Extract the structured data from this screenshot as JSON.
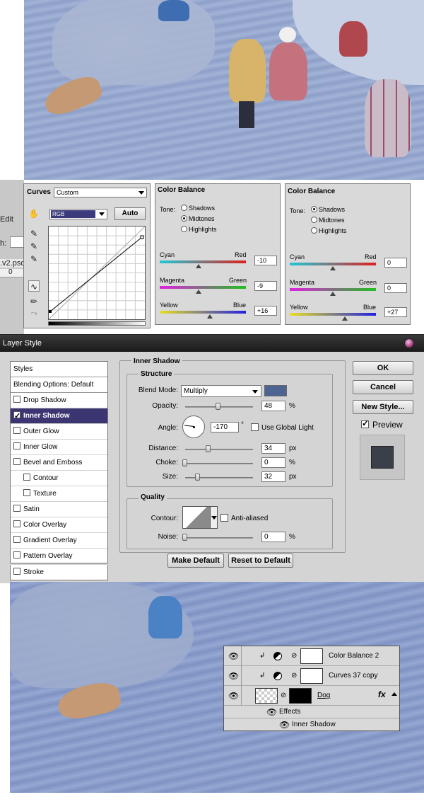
{
  "background": {
    "left_strip": {
      "menu_edit": "Edit",
      "field_label": "h:",
      "file_tab": ".v2.psd",
      "ruler_zero": "0"
    }
  },
  "curves_panel": {
    "title": "Curves",
    "preset": "Custom",
    "channel": "RGB",
    "auto_label": "Auto",
    "tool_icons": [
      "hand-icon",
      "black-eyedropper-icon",
      "gray-eyedropper-icon",
      "white-eyedropper-icon",
      "curve-tool-icon",
      "pencil-icon",
      "smooth-icon"
    ]
  },
  "color_balance_1": {
    "title": "Color Balance",
    "tone_label": "Tone:",
    "tones": [
      "Shadows",
      "Midtones",
      "Highlights"
    ],
    "selected_tone": "Midtones",
    "sliders": [
      {
        "left": "Cyan",
        "right": "Red",
        "value": "-10",
        "pos": 0.45
      },
      {
        "left": "Magenta",
        "right": "Green",
        "value": "-9",
        "pos": 0.45
      },
      {
        "left": "Yellow",
        "right": "Blue",
        "value": "+16",
        "pos": 0.58
      }
    ]
  },
  "color_balance_2": {
    "title": "Color Balance",
    "tone_label": "Tone:",
    "tones": [
      "Shadows",
      "Midtones",
      "Highlights"
    ],
    "selected_tone": "Shadows",
    "sliders": [
      {
        "left": "Cyan",
        "right": "Red",
        "value": "0",
        "pos": 0.5
      },
      {
        "left": "Magenta",
        "right": "Green",
        "value": "0",
        "pos": 0.5
      },
      {
        "left": "Yellow",
        "right": "Blue",
        "value": "+27",
        "pos": 0.64
      }
    ]
  },
  "layer_style": {
    "title": "Layer Style",
    "styles_list": [
      {
        "label": "Styles",
        "type": "head"
      },
      {
        "label": "Blending Options: Default",
        "type": "head"
      },
      {
        "label": "Drop Shadow",
        "checked": false
      },
      {
        "label": "Inner Shadow",
        "checked": true,
        "selected": true
      },
      {
        "label": "Outer Glow",
        "checked": false
      },
      {
        "label": "Inner Glow",
        "checked": false
      },
      {
        "label": "Bevel and Emboss",
        "checked": false
      },
      {
        "label": "Contour",
        "checked": false,
        "indent": true
      },
      {
        "label": "Texture",
        "checked": false,
        "indent": true
      },
      {
        "label": "Satin",
        "checked": false
      },
      {
        "label": "Color Overlay",
        "checked": false
      },
      {
        "label": "Gradient Overlay",
        "checked": false
      },
      {
        "label": "Pattern Overlay",
        "checked": false
      },
      {
        "label": "Stroke",
        "checked": false
      }
    ],
    "section_title": "Inner Shadow",
    "structure": {
      "title": "Structure",
      "blend_mode_label": "Blend Mode:",
      "blend_mode": "Multiply",
      "shadow_color": "#4d6390",
      "opacity_label": "Opacity:",
      "opacity": "48",
      "opacity_unit": "%",
      "angle_label": "Angle:",
      "angle": "-170",
      "angle_unit": "°",
      "global_light_label": "Use Global Light",
      "distance_label": "Distance:",
      "distance": "34",
      "distance_unit": "px",
      "choke_label": "Choke:",
      "choke": "0",
      "choke_unit": "%",
      "size_label": "Size:",
      "size": "32",
      "size_unit": "px"
    },
    "quality": {
      "title": "Quality",
      "contour_label": "Contour:",
      "anti_aliased_label": "Anti-aliased",
      "noise_label": "Noise:",
      "noise": "0",
      "noise_unit": "%"
    },
    "buttons": {
      "make_default": "Make Default",
      "reset_default": "Reset to Default",
      "ok": "OK",
      "cancel": "Cancel",
      "new_style": "New Style...",
      "preview": "Preview"
    }
  },
  "layers_panel": {
    "layers": [
      {
        "name": "Color Balance 2"
      },
      {
        "name": "Curves 37 copy"
      },
      {
        "name": "Dog"
      }
    ],
    "effects_label": "Effects",
    "effect_item": "Inner Shadow",
    "fx_label": "fx"
  }
}
